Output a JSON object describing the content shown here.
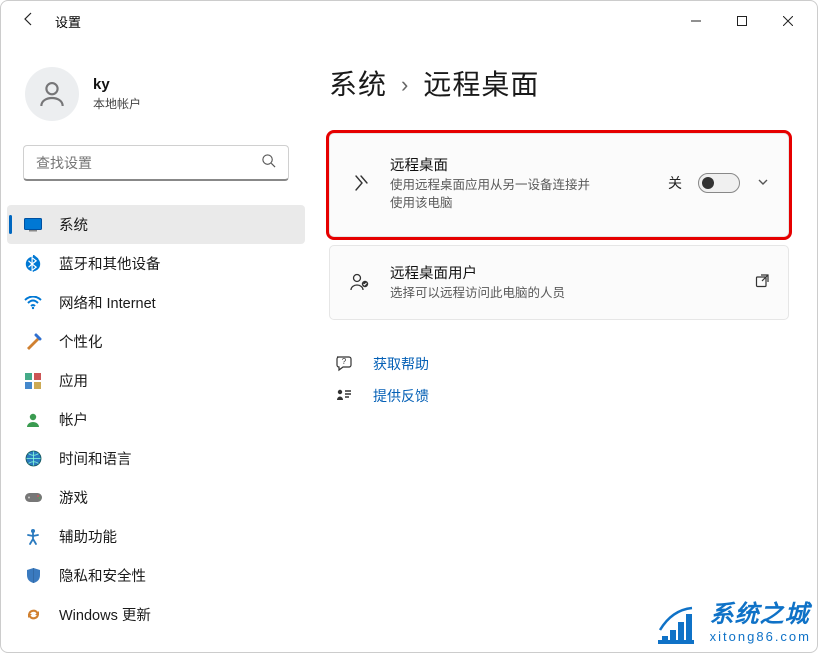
{
  "window": {
    "title": "设置"
  },
  "user": {
    "name": "ky",
    "account_type": "本地帐户"
  },
  "search": {
    "placeholder": "查找设置"
  },
  "sidebar": {
    "items": [
      {
        "label": "系统",
        "icon": "system"
      },
      {
        "label": "蓝牙和其他设备",
        "icon": "bluetooth"
      },
      {
        "label": "网络和 Internet",
        "icon": "wifi"
      },
      {
        "label": "个性化",
        "icon": "brush"
      },
      {
        "label": "应用",
        "icon": "apps"
      },
      {
        "label": "帐户",
        "icon": "person"
      },
      {
        "label": "时间和语言",
        "icon": "globe"
      },
      {
        "label": "游戏",
        "icon": "game"
      },
      {
        "label": "辅助功能",
        "icon": "accessibility"
      },
      {
        "label": "隐私和安全性",
        "icon": "shield"
      },
      {
        "label": "Windows 更新",
        "icon": "update"
      }
    ],
    "active_index": 0
  },
  "breadcrumb": {
    "parent": "系统",
    "current": "远程桌面"
  },
  "cards": {
    "remote_desktop": {
      "title": "远程桌面",
      "sub": "使用远程桌面应用从另一设备连接并使用该电脑",
      "toggle_label": "关",
      "toggle_state": "off"
    },
    "remote_users": {
      "title": "远程桌面用户",
      "sub": "选择可以远程访问此电脑的人员"
    }
  },
  "footer": {
    "help": "获取帮助",
    "feedback": "提供反馈"
  },
  "watermark": {
    "brand": "系统之城",
    "url": "xitong86.com"
  }
}
